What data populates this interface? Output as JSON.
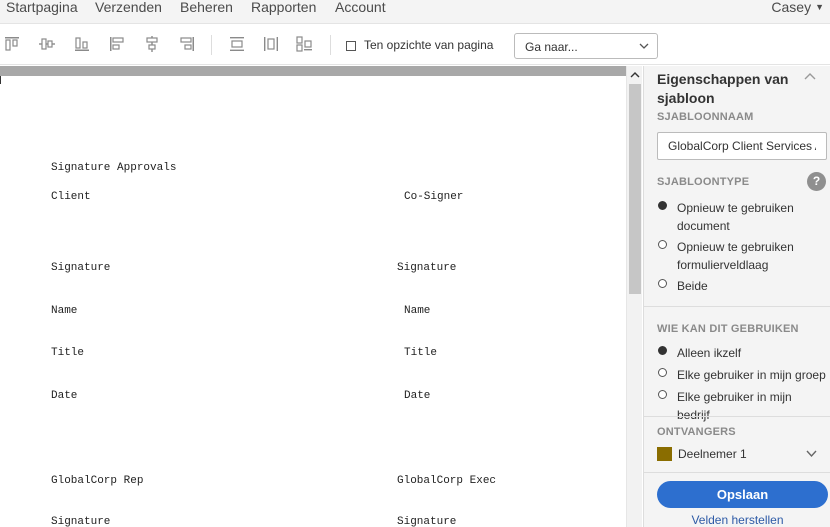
{
  "nav": {
    "items": [
      "Startpagina",
      "Verzenden",
      "Beheren",
      "Rapporten",
      "Account"
    ],
    "user": "Casey"
  },
  "toolbar": {
    "icons": [
      "align-top-icon",
      "align-vertical-center-icon",
      "align-bottom-icon",
      "align-left-icon",
      "align-horizontal-center-icon",
      "align-right-icon",
      "distribute-horizontal-icon",
      "distribute-vertical-icon",
      "match-size-icon"
    ],
    "relative_to_page_label": "Ten opzichte van pagina",
    "goto_select_value": "Ga naar..."
  },
  "document": {
    "lines": [
      {
        "left": "Signature Approvals",
        "right": ""
      },
      {
        "left": "Client",
        "right": "Co-Signer"
      },
      {
        "left": "Signature",
        "right": "Signature"
      },
      {
        "left": "Name",
        "right": "Name"
      },
      {
        "left": "Title",
        "right": "Title"
      },
      {
        "left": "Date",
        "right": "Date"
      },
      {
        "left": "GlobalCorp Rep",
        "right": "GlobalCorp Exec"
      },
      {
        "left": "Signature",
        "right": "Signature"
      }
    ]
  },
  "panel": {
    "title": "Eigenschappen van sjabloon",
    "name_label": "SJABLOONNAAM",
    "name_value": "GlobalCorp Client Services Agreement",
    "type_label": "SJABLOONTYPE",
    "help": "?",
    "type_options": [
      {
        "label": "Opnieuw te gebruiken document",
        "selected": true
      },
      {
        "label": "Opnieuw te gebruiken formulierveldlaag",
        "selected": false
      },
      {
        "label": "Beide",
        "selected": false
      }
    ],
    "who_label": "WIE KAN DIT GEBRUIKEN",
    "who_options": [
      {
        "label": "Alleen ikzelf",
        "selected": true
      },
      {
        "label": "Elke gebruiker in mijn groep",
        "selected": false
      },
      {
        "label": "Elke gebruiker in mijn bedrijf",
        "selected": false
      }
    ],
    "recipients_label": "ONTVANGERS",
    "recipient_name": "Deelnemer 1",
    "recipient_color": "#8a6d00",
    "save_label": "Opslaan",
    "reset_label": "Velden herstellen"
  },
  "colors": {
    "accent": "#2d6fcf"
  }
}
